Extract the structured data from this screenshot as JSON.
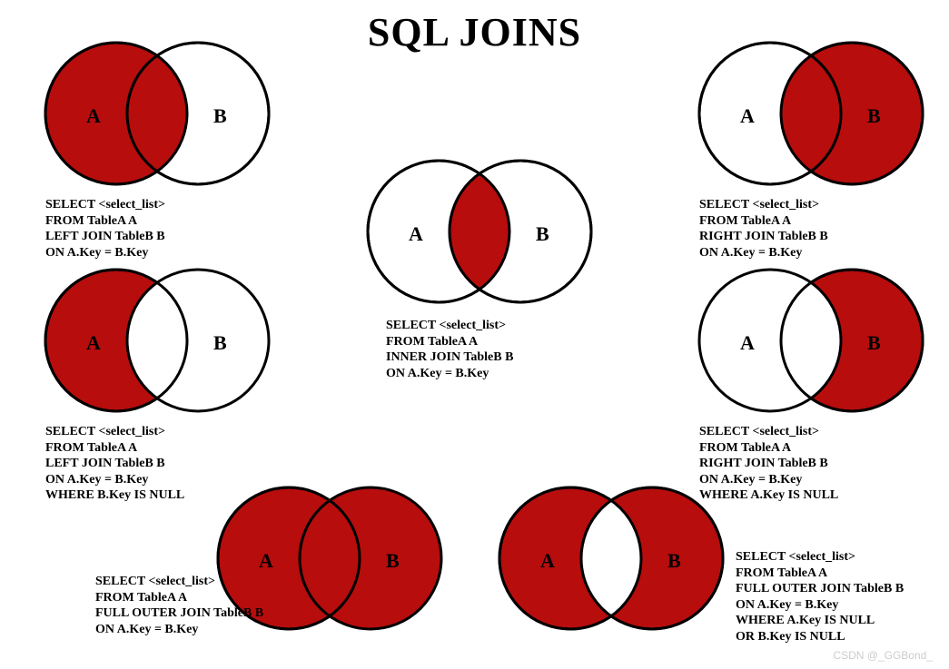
{
  "title": "SQL JOINS",
  "labelA": "A",
  "labelB": "B",
  "joins": {
    "left": {
      "sql": "SELECT <select_list>\nFROM TableA A\nLEFT JOIN TableB B\nON A.Key = B.Key"
    },
    "right": {
      "sql": "SELECT <select_list>\nFROM TableA A\nRIGHT JOIN TableB B\nON A.Key = B.Key"
    },
    "inner": {
      "sql": "SELECT <select_list>\nFROM TableA A\nINNER JOIN TableB B\nON A.Key = B.Key"
    },
    "left_excl": {
      "sql": "SELECT <select_list>\nFROM TableA A\nLEFT JOIN TableB B\nON A.Key = B.Key\nWHERE B.Key IS NULL"
    },
    "right_excl": {
      "sql": "SELECT <select_list>\nFROM TableA A\nRIGHT JOIN TableB B\nON A.Key = B.Key\nWHERE A.Key IS NULL"
    },
    "full": {
      "sql": "SELECT <select_list>\nFROM TableA A\nFULL OUTER JOIN TableB B\nON A.Key = B.Key"
    },
    "full_excl": {
      "sql": "SELECT <select_list>\nFROM TableA A\nFULL OUTER JOIN TableB B\nON A.Key = B.Key\nWHERE A.Key IS NULL\nOR B.Key IS NULL"
    }
  },
  "colors": {
    "fill": "#B70D0D",
    "stroke": "#000000"
  },
  "watermark": "CSDN @_GGBond_"
}
